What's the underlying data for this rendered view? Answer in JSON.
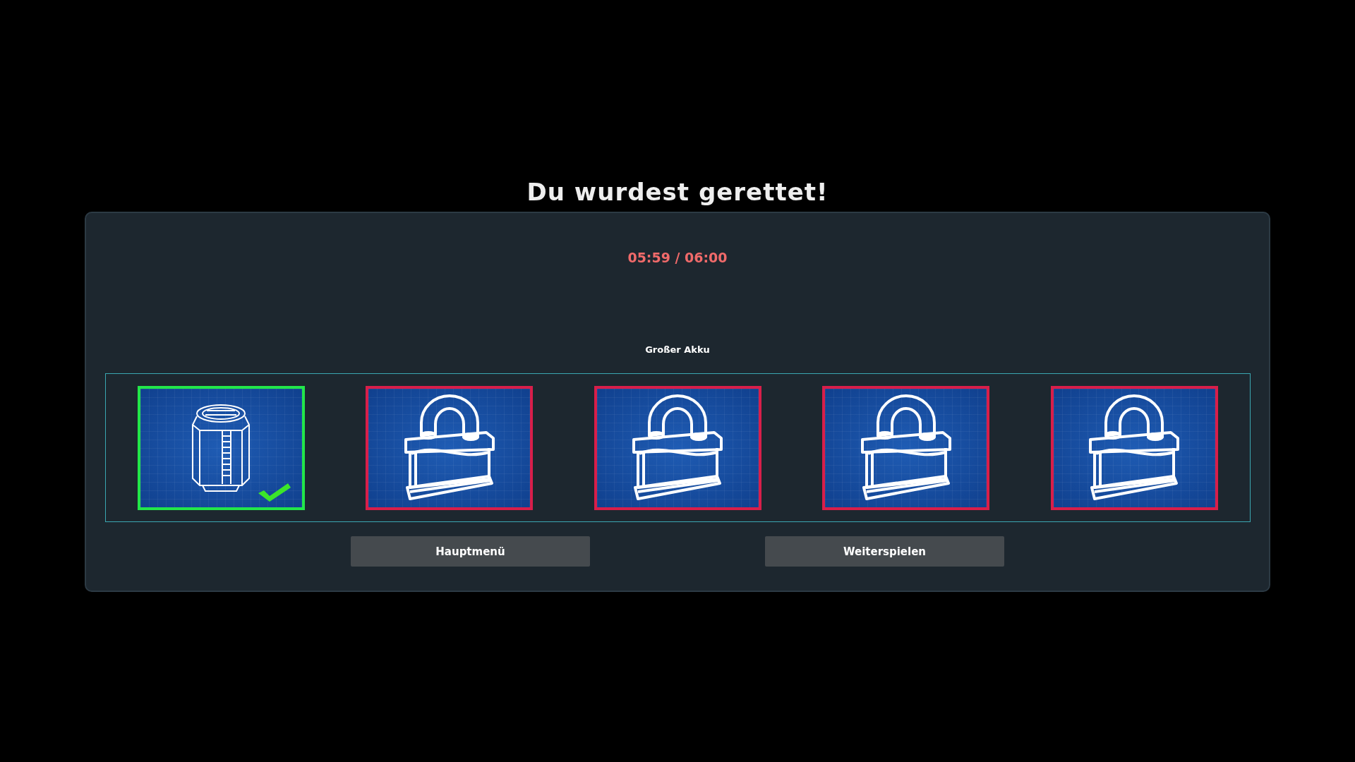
{
  "title": "Du wurdest gerettet!",
  "timer": "05:59 / 06:00",
  "item_name": "Großer Akku",
  "slots": [
    {
      "kind": "battery",
      "unlocked": true
    },
    {
      "kind": "lock",
      "unlocked": false
    },
    {
      "kind": "lock",
      "unlocked": false
    },
    {
      "kind": "lock",
      "unlocked": false
    },
    {
      "kind": "lock",
      "unlocked": false
    }
  ],
  "buttons": [
    "Hauptmenü",
    "Weiterspielen"
  ]
}
